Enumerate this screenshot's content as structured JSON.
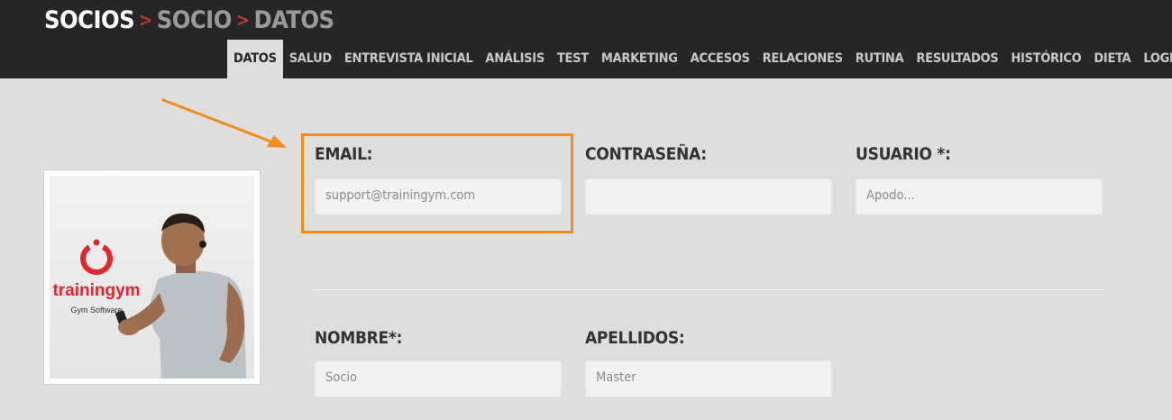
{
  "breadcrumb": {
    "items": [
      "SOCIOS",
      "SOCIO",
      "DATOS"
    ],
    "separator": ">"
  },
  "tabs": [
    {
      "label": "DATOS",
      "active": true
    },
    {
      "label": "SALUD",
      "active": false
    },
    {
      "label": "ENTREVISTA INICIAL",
      "active": false
    },
    {
      "label": "ANÁLISIS",
      "active": false
    },
    {
      "label": "TEST",
      "active": false
    },
    {
      "label": "MARKETING",
      "active": false
    },
    {
      "label": "ACCESOS",
      "active": false
    },
    {
      "label": "RELACIONES",
      "active": false
    },
    {
      "label": "RUTINA",
      "active": false
    },
    {
      "label": "RESULTADOS",
      "active": false
    },
    {
      "label": "HISTÓRICO",
      "active": false
    },
    {
      "label": "DIETA",
      "active": false
    },
    {
      "label": "LOGROS",
      "active": false
    }
  ],
  "photo": {
    "brand": "trainingym",
    "tagline": "Gym Software"
  },
  "form": {
    "email": {
      "label": "EMAIL:",
      "placeholder": "support@trainingym.com",
      "value": ""
    },
    "password": {
      "label": "CONTRASEÑA:",
      "placeholder": "",
      "value": ""
    },
    "username": {
      "label": "USUARIO *:",
      "placeholder": "Apodo...",
      "value": ""
    },
    "first_name": {
      "label": "NOMBRE*:",
      "placeholder": "Socio",
      "value": ""
    },
    "last_name": {
      "label": "APELLIDOS:",
      "placeholder": "Master",
      "value": ""
    }
  },
  "colors": {
    "topbar": "#262626",
    "background": "#dedede",
    "accent_red": "#c0392b",
    "highlight_orange": "#f28c1b",
    "brand_red": "#e3262e"
  }
}
